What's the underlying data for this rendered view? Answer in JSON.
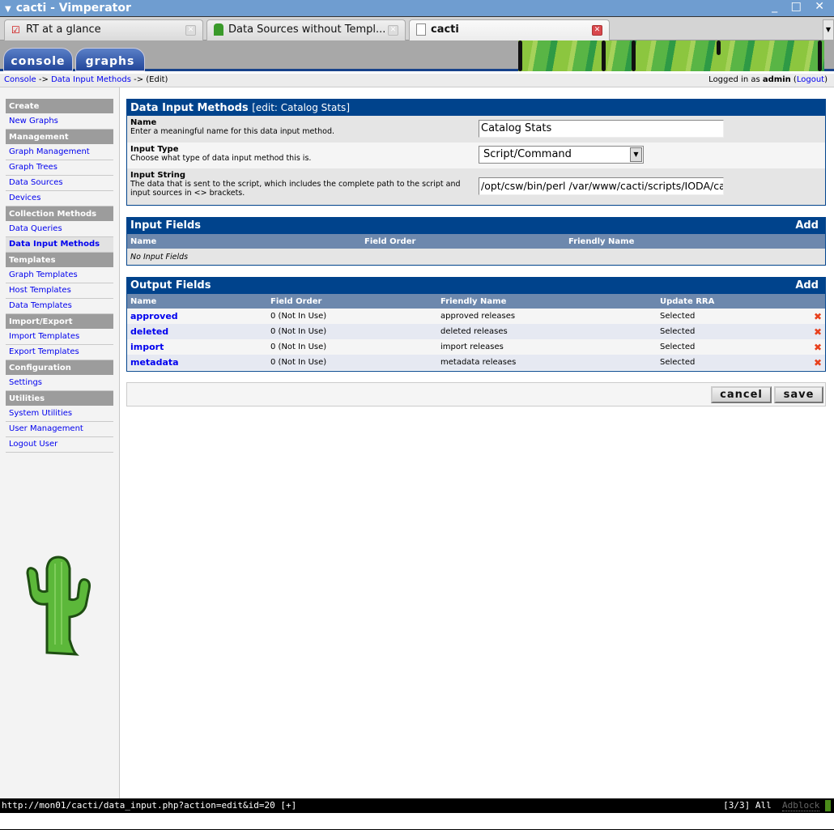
{
  "window": {
    "title": "cacti - Vimperator",
    "controls": "_ □ ✕"
  },
  "browser_tabs": [
    {
      "label": "RT at a glance",
      "icon": "checkbox-icon"
    },
    {
      "label": "Data Sources without Templ...",
      "icon": "cactus-icon"
    },
    {
      "label": "cacti",
      "icon": "page-icon",
      "active": true
    }
  ],
  "app_tabs": {
    "console": "console",
    "graphs": "graphs"
  },
  "breadcrumb": {
    "console": "Console",
    "sep": " -> ",
    "data_input": "Data Input Methods",
    "edit": "(Edit)"
  },
  "login": {
    "prefix": "Logged in as ",
    "user": "admin",
    "logout": "Logout"
  },
  "sidebar": [
    {
      "type": "header",
      "label": "Create"
    },
    {
      "type": "item",
      "label": "New Graphs"
    },
    {
      "type": "header",
      "label": "Management"
    },
    {
      "type": "item",
      "label": "Graph Management"
    },
    {
      "type": "item",
      "label": "Graph Trees"
    },
    {
      "type": "item",
      "label": "Data Sources"
    },
    {
      "type": "item",
      "label": "Devices"
    },
    {
      "type": "header",
      "label": "Collection Methods"
    },
    {
      "type": "item",
      "label": "Data Queries"
    },
    {
      "type": "item",
      "label": "Data Input Methods",
      "selected": true
    },
    {
      "type": "header",
      "label": "Templates"
    },
    {
      "type": "item",
      "label": "Graph Templates"
    },
    {
      "type": "item",
      "label": "Host Templates"
    },
    {
      "type": "item",
      "label": "Data Templates"
    },
    {
      "type": "header",
      "label": "Import/Export"
    },
    {
      "type": "item",
      "label": "Import Templates"
    },
    {
      "type": "item",
      "label": "Export Templates"
    },
    {
      "type": "header",
      "label": "Configuration"
    },
    {
      "type": "item",
      "label": "Settings"
    },
    {
      "type": "header",
      "label": "Utilities"
    },
    {
      "type": "item",
      "label": "System Utilities"
    },
    {
      "type": "item",
      "label": "User Management"
    },
    {
      "type": "item",
      "label": "Logout User"
    }
  ],
  "form": {
    "title": "Data Input Methods",
    "subtitle": "[edit: Catalog Stats]",
    "name": {
      "label": "Name",
      "desc": "Enter a meaningful name for this data input method.",
      "value": "Catalog Stats"
    },
    "input_type": {
      "label": "Input Type",
      "desc": "Choose what type of data input method this is.",
      "value": "Script/Command"
    },
    "input_string": {
      "label": "Input String",
      "desc": "The data that is sent to the script, which includes the complete path to the script and input sources in <> brackets.",
      "value": "/opt/csw/bin/perl /var/www/cacti/scripts/IODA/cat"
    }
  },
  "input_fields": {
    "title": "Input Fields",
    "add": "Add",
    "columns": [
      "Name",
      "Field Order",
      "Friendly Name"
    ],
    "empty": "No Input Fields"
  },
  "output_fields": {
    "title": "Output Fields",
    "add": "Add",
    "columns": [
      "Name",
      "Field Order",
      "Friendly Name",
      "Update RRA"
    ],
    "rows": [
      [
        "approved",
        "0 (Not In Use)",
        "approved releases",
        "Selected"
      ],
      [
        "deleted",
        "0 (Not In Use)",
        "deleted releases",
        "Selected"
      ],
      [
        "import",
        "0 (Not In Use)",
        "import releases",
        "Selected"
      ],
      [
        "metadata",
        "0 (Not In Use)",
        "metadata releases",
        "Selected"
      ]
    ]
  },
  "buttons": {
    "cancel": "cancel",
    "save": "save"
  },
  "statusbar": {
    "url": "http://mon01/cacti/data_input.php?action=edit&id=20 [+]",
    "position": "[3/3]",
    "scroll": "All",
    "adblock": "Adblock"
  },
  "colors": {
    "header_blue": "#00438c",
    "column_header": "#6d88ad",
    "delete_red": "#e8401c"
  }
}
